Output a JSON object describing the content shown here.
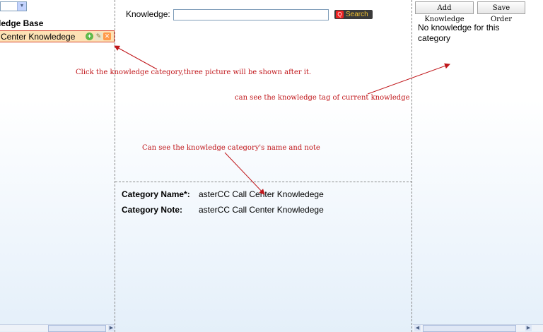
{
  "left_panel": {
    "knowledge_base_title": "ledge Base",
    "tree_node_label": "l Center Knowledege"
  },
  "search": {
    "label": "Knowledge:",
    "input_value": "",
    "button_label": "Search"
  },
  "category": {
    "name_label": "Category Name*:",
    "name_value": "asterCC Call Center Knowledege",
    "note_label": "Category Note:",
    "note_value": "asterCC Call Center Knowledege"
  },
  "right_panel": {
    "add_button": "Add Knowledge",
    "save_button": "Save Order",
    "empty_message": "No knowledge for this category"
  },
  "annotations": {
    "click_category": "Click the knowledge category,three picture will be shown after it.",
    "see_tag": "can see the knowledge tag of current knowledge",
    "see_name_note": "Can see the knowledge category's name and note"
  },
  "colors": {
    "annotation": "#c0161a",
    "selected_node_bg": "#fde2b5",
    "selected_node_border": "#d9452c",
    "search_text": "#f2c12e"
  }
}
